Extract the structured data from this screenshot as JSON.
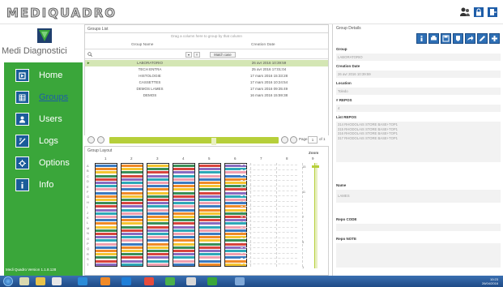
{
  "app": {
    "title": "MEDIQUADRO"
  },
  "brand": {
    "name": "Medi Diagnostici"
  },
  "header_icons": [
    "users-icon",
    "lock-icon",
    "exit-icon"
  ],
  "nav": {
    "items": [
      {
        "label": "Home",
        "icon": "home-icon",
        "active": false
      },
      {
        "label": "Groups",
        "icon": "grid-icon",
        "active": true
      },
      {
        "label": "Users",
        "icon": "user-icon",
        "active": false
      },
      {
        "label": "Logs",
        "icon": "log-icon",
        "active": false
      },
      {
        "label": "Options",
        "icon": "options-icon",
        "active": false
      },
      {
        "label": "Info",
        "icon": "info-icon",
        "active": false
      }
    ],
    "version": "Medi Quadro Version 1.1.8.128"
  },
  "groups_list": {
    "title": "Groups List",
    "drag_hint": "Drag a column here to group by that column",
    "columns": [
      "Group Name",
      "Creation Date"
    ],
    "filter_buttons": [
      "▾",
      "×",
      "Match case"
    ],
    "rows": [
      {
        "name": "LABORATORIO",
        "date": "26 avr 2016 10:39:59",
        "selected": true
      },
      {
        "name": "TECH ENTRA",
        "date": "25 avr 2016 17:01:04",
        "selected": false
      },
      {
        "name": "HISTOLOGIE",
        "date": "17 mars 2016 15:33:28",
        "selected": false
      },
      {
        "name": "CASSETTES",
        "date": "17 mars 2016 10:24:54",
        "selected": false
      },
      {
        "name": "DEMOS LAMES",
        "date": "17 mars 2016 09:35:49",
        "selected": false
      },
      {
        "name": "DEMOS",
        "date": "16 mars 2016 15:59:38",
        "selected": false
      }
    ]
  },
  "pager": {
    "page_label": "Page",
    "page_value": "1",
    "of_label": "of 1"
  },
  "layout": {
    "title": "Group Layout",
    "columns": [
      "1",
      "2",
      "3",
      "4",
      "5",
      "6",
      "7",
      "8",
      "9",
      "10",
      "11"
    ],
    "rows": [
      "A",
      "B",
      "C",
      "D",
      "E",
      "F",
      "G",
      "H",
      "I",
      "J",
      "K",
      "L",
      "M",
      "N",
      "O",
      "P",
      "Q",
      "R",
      "S",
      "T"
    ],
    "zoom_label": "Zoom",
    "zoom_ticks": [
      "15",
      "11",
      "7",
      "3",
      "1"
    ],
    "stripe_colors": [
      "#3c7bc0",
      "#f08a28",
      "#f5c431",
      "#3a8f58",
      "#d8453d",
      "#8a6bbf",
      "#2ea8b8",
      "#f0a0b0"
    ]
  },
  "details": {
    "title": "Group Details",
    "action_icons": [
      "info-icon",
      "print-icon",
      "save-icon",
      "export-icon",
      "share-icon",
      "edit-icon",
      "add-icon"
    ],
    "fields": [
      {
        "label": "Group",
        "value": "LABORATORIO"
      },
      {
        "label": "Creation Date",
        "value": "26 avr 2016 10:39:59"
      },
      {
        "label": "Location",
        "value": "Toledo"
      },
      {
        "label": "# REPOS",
        "value": "4"
      }
    ],
    "repos_label": "List REPOS",
    "repos": [
      "314 RHODOLAIS STORE BASE+TOP1",
      "315 RHODOLAIS STORE BASE+TOP1",
      "316 RHODOLAIS STORE BASE+TOP1",
      "317 RHODOLAIS STORE BASE+TOP1"
    ],
    "name_label": "Name",
    "name_value": "LAMES",
    "repo_code_label": "Repo CODE",
    "repo_note_label": "Repo NOTE"
  },
  "taskbar": {
    "time": "10:23",
    "date": "26/04/2016"
  }
}
